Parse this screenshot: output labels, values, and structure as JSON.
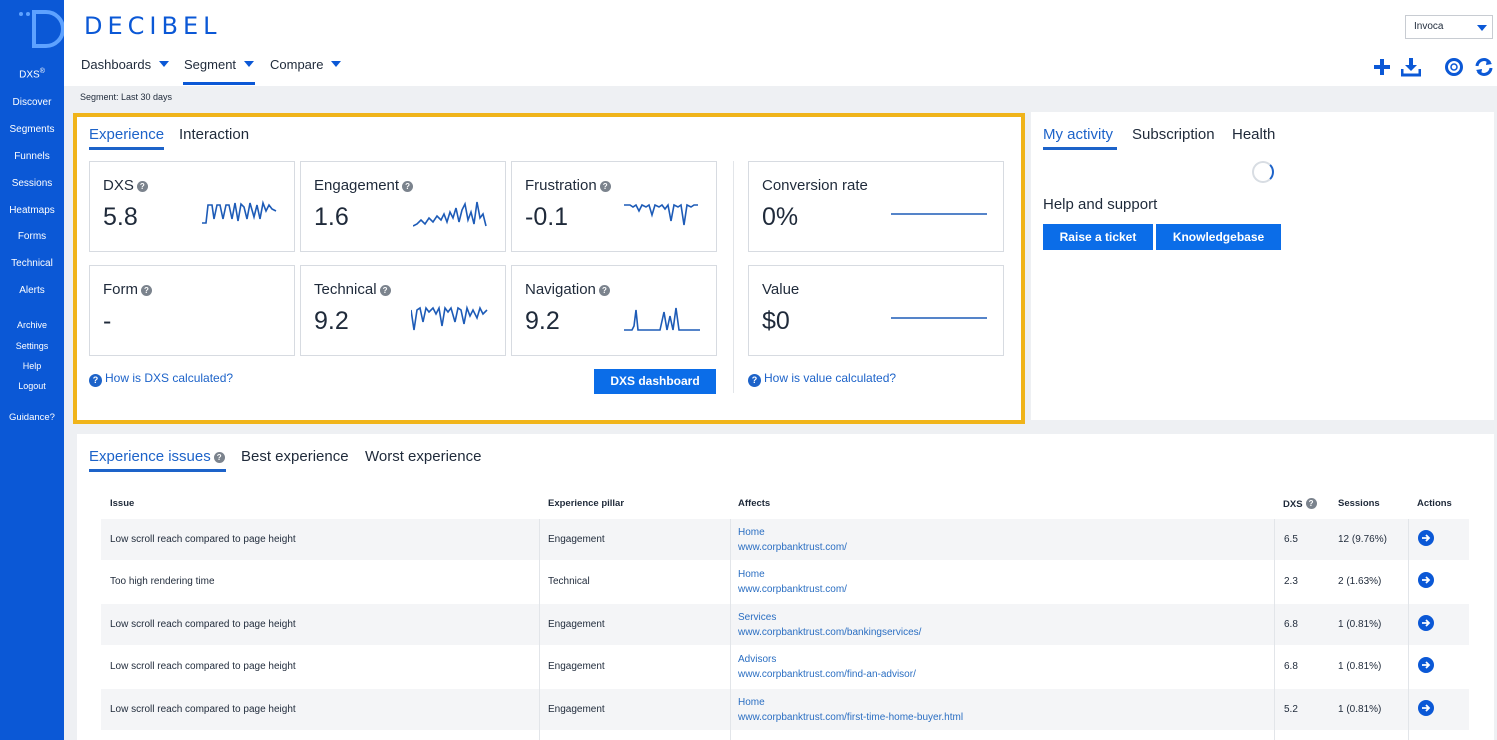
{
  "brand": {
    "name": "DECIBEL"
  },
  "sidebar": {
    "items": [
      {
        "label": "DXS",
        "sup": "®"
      },
      {
        "label": "Discover"
      },
      {
        "label": "Segments"
      },
      {
        "label": "Funnels"
      },
      {
        "label": "Sessions"
      },
      {
        "label": "Heatmaps"
      },
      {
        "label": "Forms"
      },
      {
        "label": "Technical"
      },
      {
        "label": "Alerts"
      },
      {
        "label": "Archive"
      },
      {
        "label": "Settings"
      },
      {
        "label": "Help"
      },
      {
        "label": "Logout"
      },
      {
        "label": "Guidance?"
      }
    ]
  },
  "header": {
    "account": "Invoca",
    "nav": [
      {
        "label": "Dashboards"
      },
      {
        "label": "Segment"
      },
      {
        "label": "Compare"
      }
    ],
    "icons": [
      "plus-icon",
      "download-icon",
      "support-icon",
      "refresh-icon"
    ]
  },
  "segment_label": "Segment: Last 30 days",
  "experience": {
    "tabs": [
      "Experience",
      "Interaction"
    ],
    "cards": [
      {
        "label": "DXS",
        "value": "5.8",
        "help": true
      },
      {
        "label": "Engagement",
        "value": "1.6",
        "help": true
      },
      {
        "label": "Frustration",
        "value": "-0.1",
        "help": true
      },
      {
        "label": "Form",
        "value": "-",
        "help": true
      },
      {
        "label": "Technical",
        "value": "9.2",
        "help": true
      },
      {
        "label": "Navigation",
        "value": "9.2",
        "help": true
      }
    ],
    "value_cards": [
      {
        "label": "Conversion rate",
        "value": "0%"
      },
      {
        "label": "Value",
        "value": "$0"
      }
    ],
    "dxs_help_link": "How is DXS calculated?",
    "dxs_dashboard_button": "DXS dashboard",
    "value_help_link": "How is value calculated?"
  },
  "activity": {
    "tabs": [
      "My activity",
      "Subscription",
      "Health"
    ],
    "help_title": "Help and support",
    "raise_ticket": "Raise a ticket",
    "knowledgebase": "Knowledgebase"
  },
  "issues": {
    "tabs": [
      "Experience issues",
      "Best experience",
      "Worst experience"
    ],
    "columns": [
      "Issue",
      "Experience pillar",
      "Affects",
      "DXS",
      "Sessions",
      "Actions"
    ],
    "rows": [
      {
        "issue": "Low scroll reach compared to page height",
        "pillar": "Engagement",
        "page": "Home",
        "url": "www.corpbanktrust.com/",
        "dxs": "6.5",
        "sessions": "12 (9.76%)"
      },
      {
        "issue": "Too high rendering time",
        "pillar": "Technical",
        "page": "Home",
        "url": "www.corpbanktrust.com/",
        "dxs": "2.3",
        "sessions": "2 (1.63%)"
      },
      {
        "issue": "Low scroll reach compared to page height",
        "pillar": "Engagement",
        "page": "Services",
        "url": "www.corpbanktrust.com/bankingservices/",
        "dxs": "6.8",
        "sessions": "1 (0.81%)"
      },
      {
        "issue": "Low scroll reach compared to page height",
        "pillar": "Engagement",
        "page": "Advisors",
        "url": "www.corpbanktrust.com/find-an-advisor/",
        "dxs": "6.8",
        "sessions": "1 (0.81%)"
      },
      {
        "issue": "Low scroll reach compared to page height",
        "pillar": "Engagement",
        "page": "Home",
        "url": "www.corpbanktrust.com/first-time-home-buyer.html",
        "dxs": "5.2",
        "sessions": "1 (0.81%)"
      }
    ]
  },
  "colors": {
    "brand_blue": "#0b58d6",
    "highlight": "#f0b41a",
    "link": "#1d63c9"
  }
}
